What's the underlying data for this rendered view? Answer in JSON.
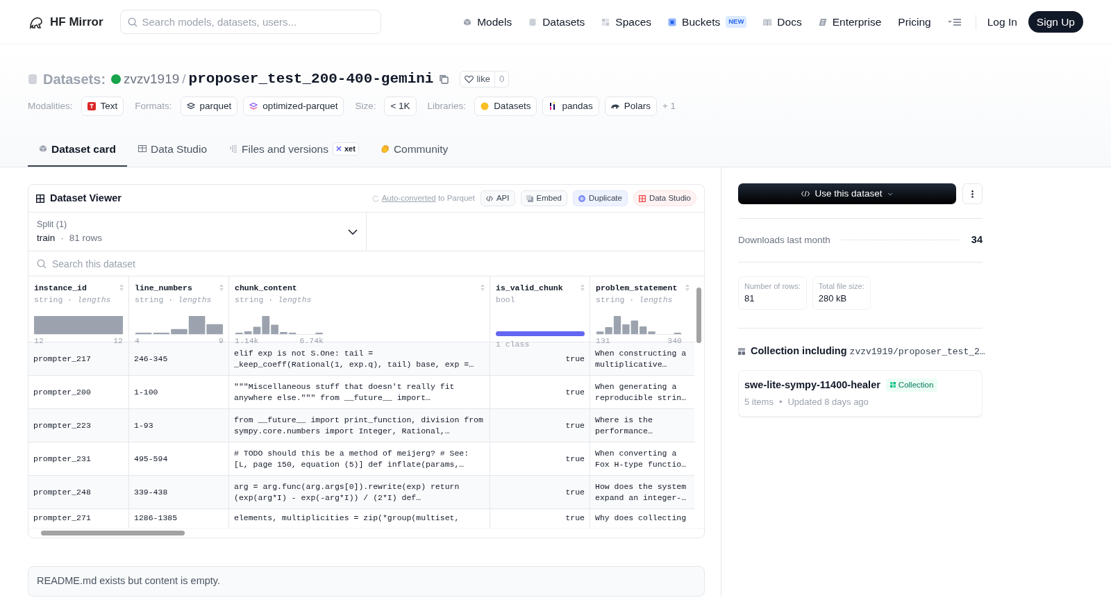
{
  "navbar": {
    "brand": "HF Mirror",
    "search": {
      "placeholder": "Search models, datasets, users..."
    },
    "links": [
      {
        "label": "Models"
      },
      {
        "label": "Datasets"
      },
      {
        "label": "Spaces"
      },
      {
        "label": "Buckets",
        "badge": "NEW"
      },
      {
        "label": "Docs"
      },
      {
        "label": "Enterprise"
      },
      {
        "label": "Pricing"
      }
    ],
    "login": "Log In",
    "signup": "Sign Up"
  },
  "repo": {
    "prefix": "Datasets:",
    "owner": "zvzv1919",
    "separator": "/",
    "name": "proposer_test_200-400-gemini",
    "like": {
      "label": "like",
      "count": "0"
    }
  },
  "tag_groups": [
    {
      "label": "Modalities:",
      "chips": [
        {
          "label": "Text"
        }
      ]
    },
    {
      "label": "Formats:",
      "chips": [
        {
          "label": "parquet"
        },
        {
          "label": "optimized-parquet"
        }
      ]
    },
    {
      "label": "Size:",
      "chips": [
        {
          "label": "< 1K"
        }
      ]
    },
    {
      "label": "Libraries:",
      "chips": [
        {
          "label": "Datasets"
        },
        {
          "label": "pandas"
        },
        {
          "label": "Polars"
        }
      ],
      "more": "+ 1"
    }
  ],
  "tabs": [
    {
      "label": "Dataset card",
      "selected": true
    },
    {
      "label": "Data Studio",
      "selected": false
    },
    {
      "label": "Files and versions",
      "selected": false,
      "badge": "xet"
    },
    {
      "label": "Community",
      "selected": false
    }
  ],
  "viewer": {
    "title": "Dataset Viewer",
    "converted": {
      "link": "Auto-converted",
      "rest": "to Parquet"
    },
    "buttons": [
      {
        "label": "API",
        "kind": "api"
      },
      {
        "label": "Embed",
        "kind": "embed"
      },
      {
        "label": "Duplicate",
        "kind": "duplicate"
      },
      {
        "label": "Data Studio",
        "kind": "studio"
      }
    ],
    "split": {
      "label": "Split (1)",
      "name": "train",
      "separator": "·",
      "rows": "81 rows"
    },
    "search": {
      "placeholder": "Search this dataset"
    },
    "columns": [
      {
        "name": "instance_id",
        "type": "string · *lengths*",
        "kind": "histogram",
        "min": "12",
        "max": "12"
      },
      {
        "name": "line_numbers",
        "type": "string · *lengths*",
        "kind": "histogram",
        "min": "4",
        "max": "9"
      },
      {
        "name": "chunk_content",
        "type": "string · *lengths*",
        "kind": "histogram",
        "min": "1.14k",
        "max": "6.74k"
      },
      {
        "name": "is_valid_chunk",
        "type": "bool",
        "kind": "classes",
        "summary": "1 class"
      },
      {
        "name": "problem_statement",
        "type": "string · *lengths*",
        "kind": "histogram",
        "min": "131",
        "max": "340"
      }
    ],
    "rows": [
      [
        "prompter_217",
        "246-345",
        "elif exp is not S.One: tail = _keep_coeff(Rational(1, exp.q), tail) base, exp =…",
        "true",
        "When constructing a multiplicative…"
      ],
      [
        "prompter_200",
        "1-100",
        "\"\"\"Miscellaneous stuff that doesn't really fit anywhere else.\"\"\" from __future__ import…",
        "true",
        "When generating a reproducible strin…"
      ],
      [
        "prompter_223",
        "1-93",
        "from __future__ import print_function, division from sympy.core.numbers import Integer, Rational,…",
        "true",
        "Where is the performance…"
      ],
      [
        "prompter_231",
        "495-594",
        "# TODO should this be a method of meijerg? # See: [L, page 150, equation (5)] def inflate(params,…",
        "true",
        "When converting a Fox H-type functio…"
      ],
      [
        "prompter_248",
        "339-438",
        "arg = arg.func(arg.args[0]).rewrite(exp) return (exp(arg*I) - exp(-arg*I)) / (2*I) def…",
        "true",
        "How does the system expand an integer-…"
      ],
      [
        "prompter_271",
        "1286-1385",
        "elements, multiplicities = zip(*group(multiset,",
        "true",
        "Why does collecting"
      ]
    ]
  },
  "readme": "README.md exists but content is empty.",
  "sidebar": {
    "use_button": "Use this dataset",
    "downloads": {
      "label": "Downloads last month",
      "value": "34"
    },
    "stats": [
      {
        "label": "Number of rows:",
        "value": "81"
      },
      {
        "label": "Total file size:",
        "value": "280 kB"
      }
    ],
    "collections": {
      "title": "Collection including",
      "repo": "zvzv1919/proposer_test_2…",
      "items": [
        {
          "name": "swe-lite-sympy-11400-healer",
          "badge": "Collection",
          "count": "5 items",
          "separator": "•",
          "updated": "Updated 8 days ago"
        }
      ]
    }
  }
}
